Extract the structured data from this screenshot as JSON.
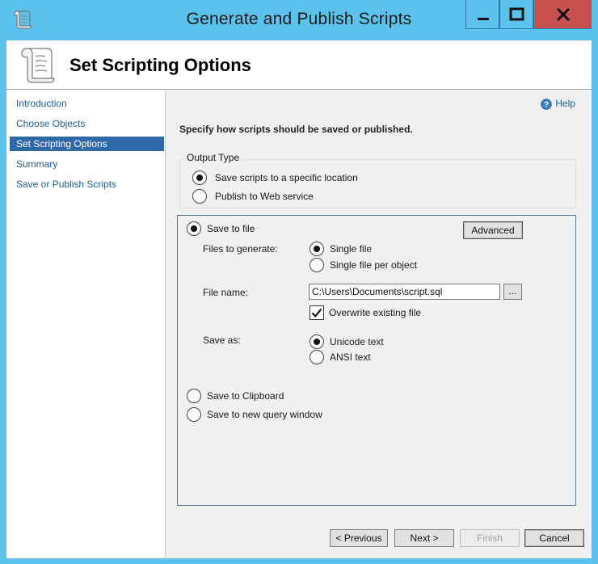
{
  "window": {
    "title": "Generate and Publish Scripts",
    "icon": "scroll-icon",
    "titlebar_color": "#5ac2ec",
    "close_color": "#c7504f"
  },
  "header": {
    "title": "Set Scripting Options",
    "icon": "scroll-icon"
  },
  "sidebar": {
    "selected_color": "#3069a9",
    "items": [
      {
        "label": "Introduction",
        "selected": false
      },
      {
        "label": "Choose Objects",
        "selected": false
      },
      {
        "label": "Set Scripting Options",
        "selected": true
      },
      {
        "label": "Summary",
        "selected": false
      },
      {
        "label": "Save or Publish Scripts",
        "selected": false
      }
    ]
  },
  "main": {
    "help_label": "Help",
    "instruction": "Specify how scripts should be saved or published.",
    "output_type": {
      "label": "Output Type",
      "options": [
        {
          "label": "Save scripts to a specific location",
          "checked": true
        },
        {
          "label": "Publish to Web service",
          "checked": false
        }
      ]
    },
    "save_to_file": {
      "label": "Save to file",
      "checked": true,
      "advanced_label": "Advanced",
      "files_to_generate": {
        "label": "Files to generate:",
        "options": [
          {
            "label": "Single file",
            "checked": true
          },
          {
            "label": "Single file per object",
            "checked": false
          }
        ]
      },
      "file_name": {
        "label": "File name:",
        "value": "C:\\Users\\Documents\\script.sql",
        "browse_label": "..."
      },
      "overwrite": {
        "label": "Overwrite existing file",
        "checked": true
      },
      "save_as": {
        "label": "Save as:",
        "options": [
          {
            "label": "Unicode text",
            "checked": true
          },
          {
            "label": "ANSI text",
            "checked": false
          }
        ]
      }
    },
    "save_to_clipboard": {
      "label": "Save to Clipboard",
      "checked": false
    },
    "save_to_query_window": {
      "label": "Save to new query window",
      "checked": false
    }
  },
  "footer": {
    "previous_label": "< Previous",
    "next_label": "Next >",
    "finish_label": "Finish",
    "finish_enabled": false,
    "cancel_label": "Cancel"
  }
}
